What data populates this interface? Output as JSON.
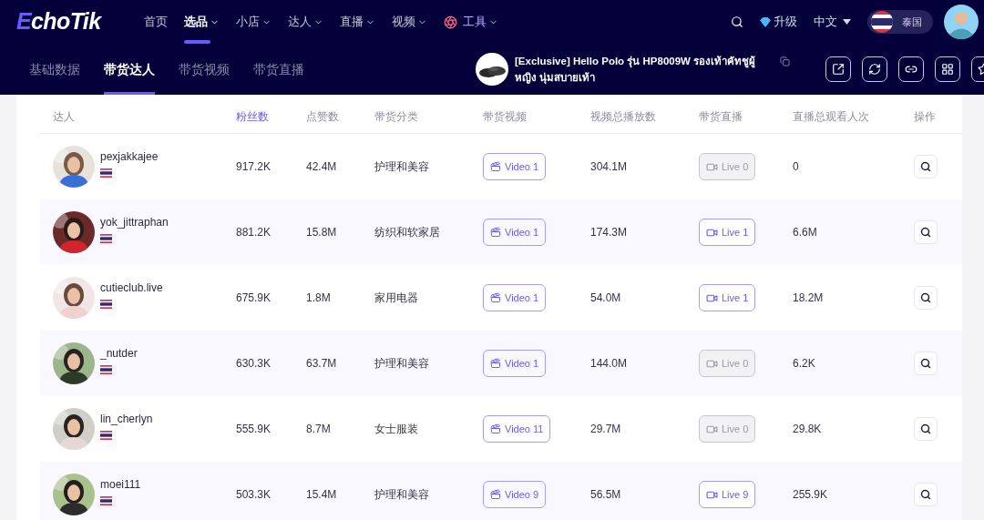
{
  "logo": "EchoTik",
  "nav": [
    {
      "label": "首页",
      "kind": "link",
      "dropdown": false,
      "selected": false
    },
    {
      "label": "选品",
      "kind": "link",
      "dropdown": true,
      "selected": true
    },
    {
      "label": "小店",
      "kind": "link",
      "dropdown": true,
      "selected": false
    },
    {
      "label": "达人",
      "kind": "link",
      "dropdown": true,
      "selected": false
    },
    {
      "label": "直播",
      "kind": "link",
      "dropdown": true,
      "selected": false
    },
    {
      "label": "视频",
      "kind": "link",
      "dropdown": true,
      "selected": false
    },
    {
      "label": "工具",
      "kind": "tool",
      "dropdown": true,
      "selected": false
    }
  ],
  "upgrade": "升级",
  "language": "中文",
  "country": "泰国",
  "subtabs": [
    {
      "label": "基础数据",
      "selected": false
    },
    {
      "label": "带货达人",
      "selected": true
    },
    {
      "label": "带货视频",
      "selected": false
    },
    {
      "label": "带货直播",
      "selected": false
    }
  ],
  "product": {
    "title": "[Exclusive] Hello Polo รุ่น HP8009W รองเท้าคัทชูผู้หญิง นุ่มสบายเท้า"
  },
  "columns": [
    {
      "label": "达人",
      "sorted": false
    },
    {
      "label": "粉丝数",
      "sorted": true
    },
    {
      "label": "点赞数",
      "sorted": false
    },
    {
      "label": "带货分类",
      "sorted": false
    },
    {
      "label": "带货视频",
      "sorted": false
    },
    {
      "label": "视频总播放数",
      "sorted": false
    },
    {
      "label": "带货直播",
      "sorted": false
    },
    {
      "label": "直播总观看人次",
      "sorted": false
    },
    {
      "label": "操作",
      "sorted": false
    }
  ],
  "rows": [
    {
      "name": "pexjakkajee",
      "followers": "917.2K",
      "likes": "42.4M",
      "category": "护理和美容",
      "video": "Video 1",
      "views": "304.1M",
      "live": {
        "label": "Live 0",
        "disabled": true
      },
      "live_views": "0"
    },
    {
      "name": "yok_jittraphan",
      "followers": "881.2K",
      "likes": "15.8M",
      "category": "纺织和软家居",
      "video": "Video 1",
      "views": "174.3M",
      "live": {
        "label": "Live 1",
        "disabled": false
      },
      "live_views": "6.6M"
    },
    {
      "name": "cutieclub.live",
      "followers": "675.9K",
      "likes": "1.8M",
      "category": "家用电器",
      "video": "Video 1",
      "views": "54.0M",
      "live": {
        "label": "Live 1",
        "disabled": false
      },
      "live_views": "18.2M"
    },
    {
      "name": "_nutder",
      "followers": "630.3K",
      "likes": "63.7M",
      "category": "护理和美容",
      "video": "Video 1",
      "views": "144.0M",
      "live": {
        "label": "Live 0",
        "disabled": true
      },
      "live_views": "6.2K"
    },
    {
      "name": "lin_cherlyn",
      "followers": "555.9K",
      "likes": "8.7M",
      "category": "女士服装",
      "video": "Video 11",
      "views": "29.7M",
      "live": {
        "label": "Live 0",
        "disabled": true
      },
      "live_views": "29.8K"
    },
    {
      "name": "moei111",
      "followers": "503.3K",
      "likes": "15.4M",
      "category": "护理和美容",
      "video": "Video 9",
      "views": "56.5M",
      "live": {
        "label": "Live 9",
        "disabled": false
      },
      "live_views": "255.9K"
    }
  ]
}
